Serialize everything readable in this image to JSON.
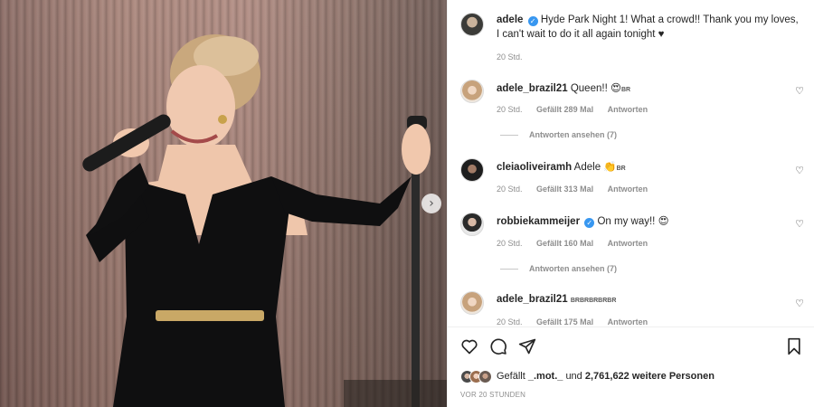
{
  "post": {
    "author": "adele",
    "caption": "Hyde Park Night 1! What a crowd!! Thank you my loves, I can't wait to do it all again tonight ♥",
    "caption_line1": "Hyde Park Night 1! What a crowd!! Thank you my loves,",
    "caption_line2": "I can't wait to do it all again tonight ♥",
    "age": "20 Std.",
    "verified_icon": "verified-badge-icon",
    "next_icon": "chevron-right-icon"
  },
  "comments": [
    {
      "username": "adele_brazil21",
      "text": "Queen!! 😍🇧🇷",
      "text_main": "Queen!!",
      "text_emoji": "😍",
      "flag": "BR",
      "verified": false,
      "age": "20 Std.",
      "likes": "Gefällt 289 Mal",
      "reply": "Antworten",
      "view_replies": "Antworten ansehen (7)"
    },
    {
      "username": "cleiaoliveiramh",
      "text": "Adele 👏🇧🇷",
      "text_main": "Adele",
      "text_emoji": "👏",
      "flag": "BR",
      "verified": false,
      "age": "20 Std.",
      "likes": "Gefällt 313 Mal",
      "reply": "Antworten"
    },
    {
      "username": "robbiekammeijer",
      "text": "On my way!! 😍",
      "text_main": "On my way!!",
      "text_emoji": "😍",
      "verified": true,
      "age": "20 Std.",
      "likes": "Gefällt 160 Mal",
      "reply": "Antworten",
      "view_replies": "Antworten ansehen (7)"
    },
    {
      "username": "adele_brazil21",
      "text": "🇧🇷🇧🇷🇧🇷🇧🇷🇧🇷",
      "flag": "BRBRBRBRBR",
      "verified": false,
      "age": "20 Std.",
      "likes": "Gefällt 175 Mal",
      "reply": "Antworten"
    }
  ],
  "actions": {
    "like_icon": "heart-icon",
    "comment_icon": "comment-icon",
    "share_icon": "send-icon",
    "save_icon": "bookmark-icon"
  },
  "likes_summary": {
    "prefix": "Gefällt",
    "user": "_.mot._",
    "connector": "und",
    "count": "2,761,622",
    "suffix": "weitere Personen"
  },
  "timestamp": "VOR 20 STUNDEN",
  "colors": {
    "verified": "#3897f0",
    "muted": "#8e8e8e",
    "text": "#262626"
  }
}
